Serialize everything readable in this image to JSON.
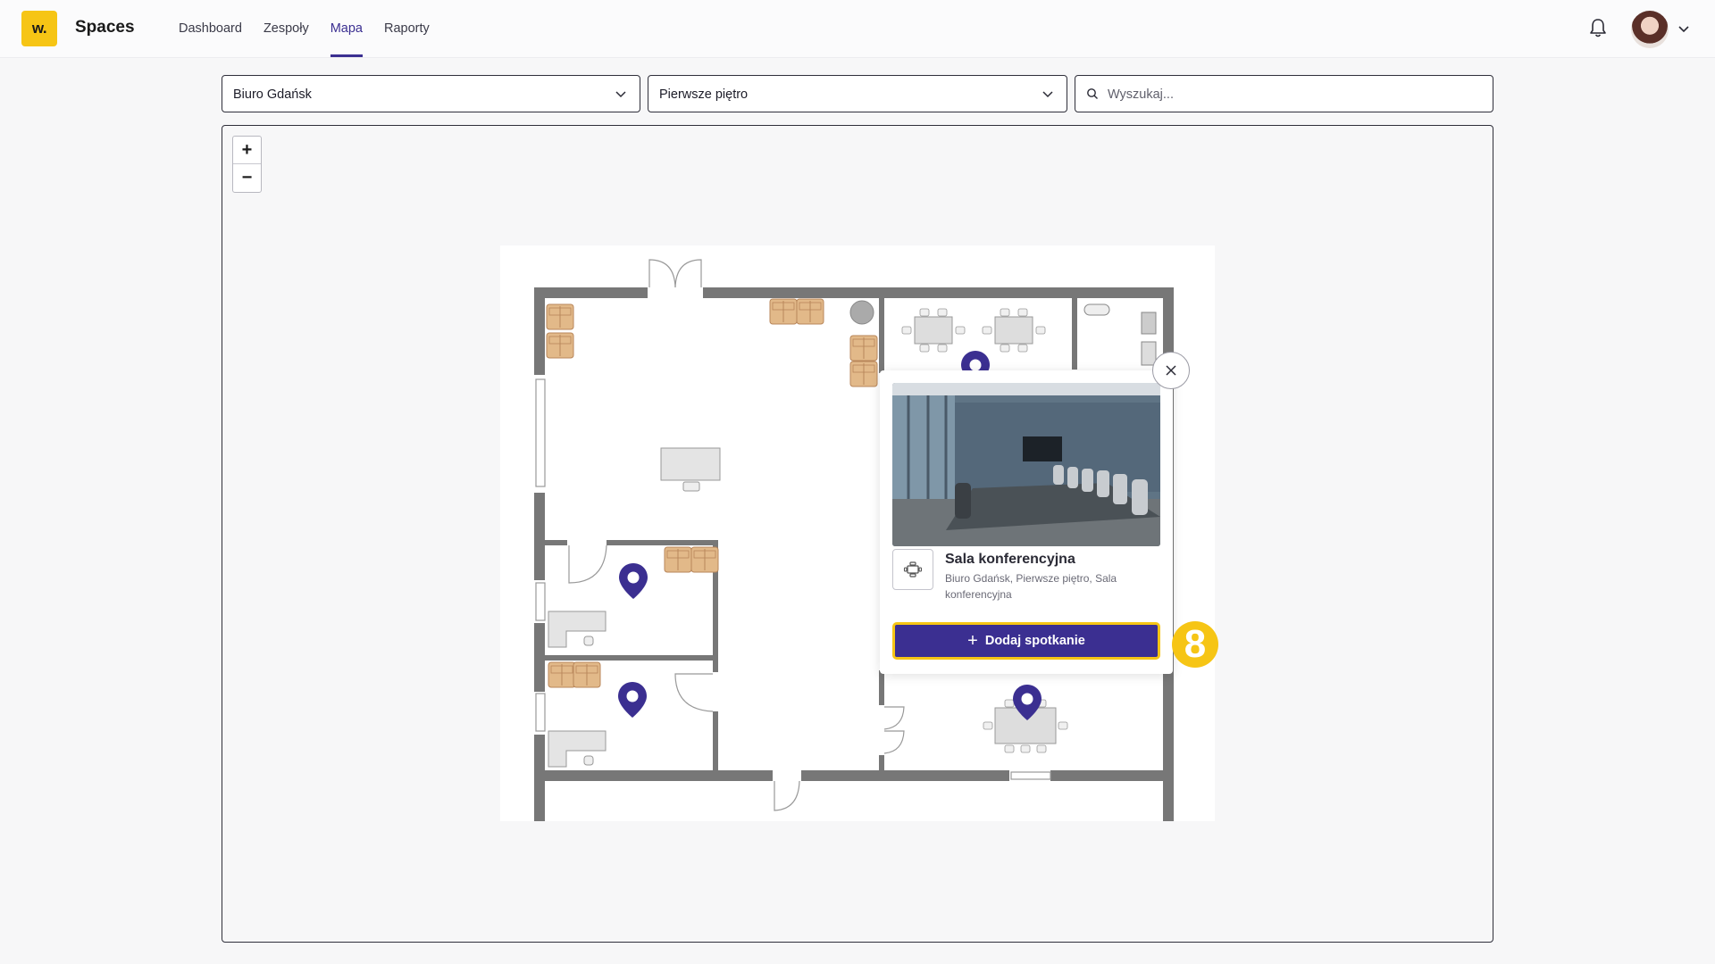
{
  "app": {
    "logo_text": "w.",
    "name": "Spaces",
    "brand_color": "#f6c515",
    "accent_color": "#3b2f91"
  },
  "nav": {
    "items": [
      {
        "label": "Dashboard",
        "active": false
      },
      {
        "label": "Zespoły",
        "active": false
      },
      {
        "label": "Mapa",
        "active": true
      },
      {
        "label": "Raporty",
        "active": false
      }
    ]
  },
  "header": {
    "notification_icon": "bell-icon",
    "user_menu_icon": "chevron-down-icon"
  },
  "filters": {
    "location": {
      "value": "Biuro Gdańsk"
    },
    "floor": {
      "value": "Pierwsze piętro"
    },
    "search": {
      "placeholder": "Wyszukaj..."
    }
  },
  "map": {
    "zoom_in": "+",
    "zoom_out": "−",
    "pin_color": "#3b2f91"
  },
  "popup": {
    "title": "Sala konferencyjna",
    "subtitle": "Biuro Gdańsk, Pierwsze piętro, Sala konferencyjna",
    "button_label": "Dodaj spotkanie",
    "room_icon": "meeting-room-icon"
  },
  "step_badge": "8"
}
